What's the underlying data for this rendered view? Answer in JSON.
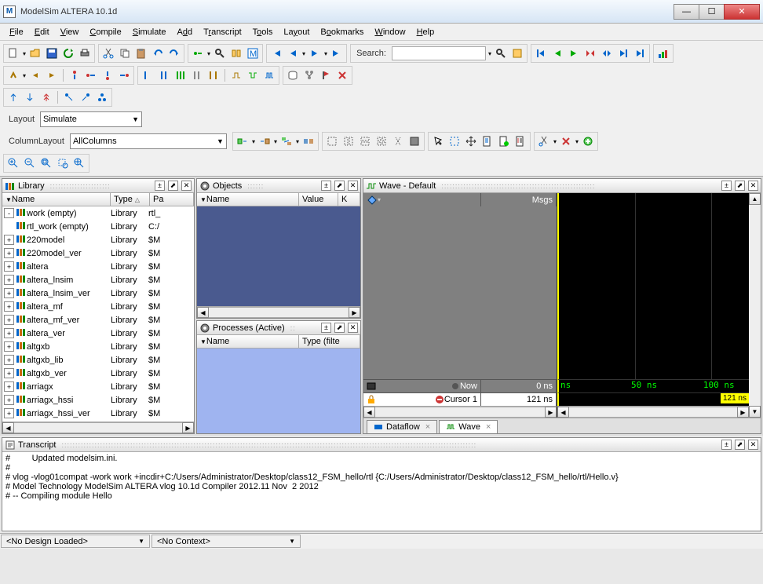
{
  "window": {
    "title": "ModelSim ALTERA 10.1d",
    "app_letter": "M"
  },
  "menu": {
    "file": "File",
    "edit": "Edit",
    "view": "View",
    "compile": "Compile",
    "simulate": "Simulate",
    "add": "Add",
    "transcript": "Transcript",
    "tools": "Tools",
    "layout": "Layout",
    "bookmarks": "Bookmarks",
    "window": "Window",
    "help": "Help"
  },
  "toolbar": {
    "search_label": "Search:",
    "search_value": "",
    "layout_label": "Layout",
    "layout_value": "Simulate",
    "col_layout_label": "ColumnLayout",
    "col_layout_value": "AllColumns"
  },
  "library": {
    "title": "Library",
    "col_name": "Name",
    "col_type": "Type",
    "col_path": "Pa",
    "items": [
      {
        "exp": "-",
        "name": "work (empty)",
        "type": "Library",
        "path": "rtl_"
      },
      {
        "exp": "",
        "name": "rtl_work (empty)",
        "type": "Library",
        "path": "C:/"
      },
      {
        "exp": "+",
        "name": "220model",
        "type": "Library",
        "path": "$M"
      },
      {
        "exp": "+",
        "name": "220model_ver",
        "type": "Library",
        "path": "$M"
      },
      {
        "exp": "+",
        "name": "altera",
        "type": "Library",
        "path": "$M"
      },
      {
        "exp": "+",
        "name": "altera_lnsim",
        "type": "Library",
        "path": "$M"
      },
      {
        "exp": "+",
        "name": "altera_lnsim_ver",
        "type": "Library",
        "path": "$M"
      },
      {
        "exp": "+",
        "name": "altera_mf",
        "type": "Library",
        "path": "$M"
      },
      {
        "exp": "+",
        "name": "altera_mf_ver",
        "type": "Library",
        "path": "$M"
      },
      {
        "exp": "+",
        "name": "altera_ver",
        "type": "Library",
        "path": "$M"
      },
      {
        "exp": "+",
        "name": "altgxb",
        "type": "Library",
        "path": "$M"
      },
      {
        "exp": "+",
        "name": "altgxb_lib",
        "type": "Library",
        "path": "$M"
      },
      {
        "exp": "+",
        "name": "altgxb_ver",
        "type": "Library",
        "path": "$M"
      },
      {
        "exp": "+",
        "name": "arriagx",
        "type": "Library",
        "path": "$M"
      },
      {
        "exp": "+",
        "name": "arriagx_hssi",
        "type": "Library",
        "path": "$M"
      },
      {
        "exp": "+",
        "name": "arriagx_hssi_ver",
        "type": "Library",
        "path": "$M"
      },
      {
        "exp": "+",
        "name": "arriagx_ver",
        "type": "Library",
        "path": "$M"
      }
    ]
  },
  "objects": {
    "title": "Objects",
    "col_name": "Name",
    "col_value": "Value",
    "col_k": "K"
  },
  "processes": {
    "title": "Processes (Active)",
    "col_name": "Name",
    "col_type": "Type (filte"
  },
  "wave": {
    "title": "Wave - Default",
    "col_msgs": "Msgs",
    "now_label": "Now",
    "now_value": "0 ns",
    "cursor_label": "Cursor 1",
    "cursor_value": "121 ns",
    "cursor_display": "121 ns",
    "ruler_start": "ns",
    "ruler_50": "50 ns",
    "ruler_100": "100 ns"
  },
  "tabs": {
    "dataflow": "Dataflow",
    "wave": "Wave"
  },
  "transcript": {
    "title": "Transcript",
    "line1": "#         Updated modelsim.ini.",
    "line2": "#",
    "line3": "# vlog -vlog01compat -work work +incdir+C:/Users/Administrator/Desktop/class12_FSM_hello/rtl {C:/Users/Administrator/Desktop/class12_FSM_hello/rtl/Hello.v}",
    "line4": "# Model Technology ModelSim ALTERA vlog 10.1d Compiler 2012.11 Nov  2 2012",
    "line5": "# -- Compiling module Hello"
  },
  "statusbar": {
    "design": "<No Design Loaded>",
    "context": "<No Context>"
  }
}
